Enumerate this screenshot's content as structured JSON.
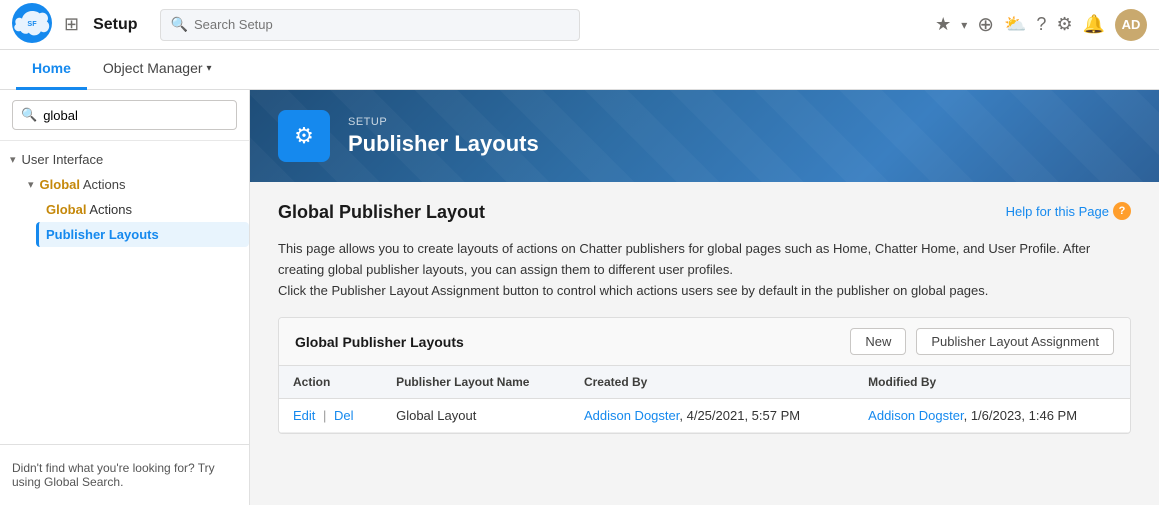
{
  "topNav": {
    "setupLabel": "Setup",
    "searchPlaceholder": "Search Setup",
    "tabs": [
      {
        "id": "home",
        "label": "Home",
        "active": true
      },
      {
        "id": "object-manager",
        "label": "Object Manager",
        "active": false,
        "hasChevron": true
      }
    ],
    "icons": {
      "grid": "⊞",
      "star": "★",
      "chevronDown": "▾",
      "add": "+",
      "cloud": "☁",
      "question": "?",
      "gear": "⚙",
      "bell": "🔔"
    },
    "avatarInitials": "AD"
  },
  "sidebar": {
    "searchValue": "global",
    "searchPlaceholder": "Search...",
    "tree": {
      "userInterface": {
        "label": "User Interface",
        "expanded": true,
        "children": {
          "globalActions": {
            "label": "Global Actions",
            "expanded": true,
            "highlightText": "Global",
            "children": [
              {
                "id": "global-actions-item",
                "label": "Global Actions",
                "highlightText": "Global",
                "active": false
              },
              {
                "id": "publisher-layouts-item",
                "label": "Publisher Layouts",
                "active": true
              }
            ]
          }
        }
      }
    },
    "notFoundText": "Didn't find what you're looking for? Try using Global Search."
  },
  "pageHeader": {
    "setupLabel": "SETUP",
    "title": "Publisher Layouts",
    "icon": "⚙"
  },
  "pageBody": {
    "sectionTitle": "Global Publisher Layout",
    "helpLinkText": "Help for this Page",
    "description1": "This page allows you to create layouts of actions on Chatter publishers for global pages such as Home, Chatter Home, and User Profile. After creating global publisher layouts, you can assign them to different user profiles.",
    "description2": "Click the Publisher Layout Assignment button to control which actions users see by default in the publisher on global pages.",
    "tableTitle": "Global Publisher Layouts",
    "newButtonLabel": "New",
    "assignmentButtonLabel": "Publisher Layout Assignment",
    "tableColumns": [
      {
        "id": "action",
        "label": "Action"
      },
      {
        "id": "layout-name",
        "label": "Publisher Layout Name"
      },
      {
        "id": "created-by",
        "label": "Created By"
      },
      {
        "id": "modified-by",
        "label": "Modified By"
      }
    ],
    "tableRows": [
      {
        "editLabel": "Edit",
        "delLabel": "Del",
        "layoutName": "Global Layout",
        "createdBy": "Addison Dogster",
        "createdDate": "4/25/2021, 5:57 PM",
        "modifiedBy": "Addison Dogster",
        "modifiedDate": "1/6/2023, 1:46 PM"
      }
    ]
  }
}
